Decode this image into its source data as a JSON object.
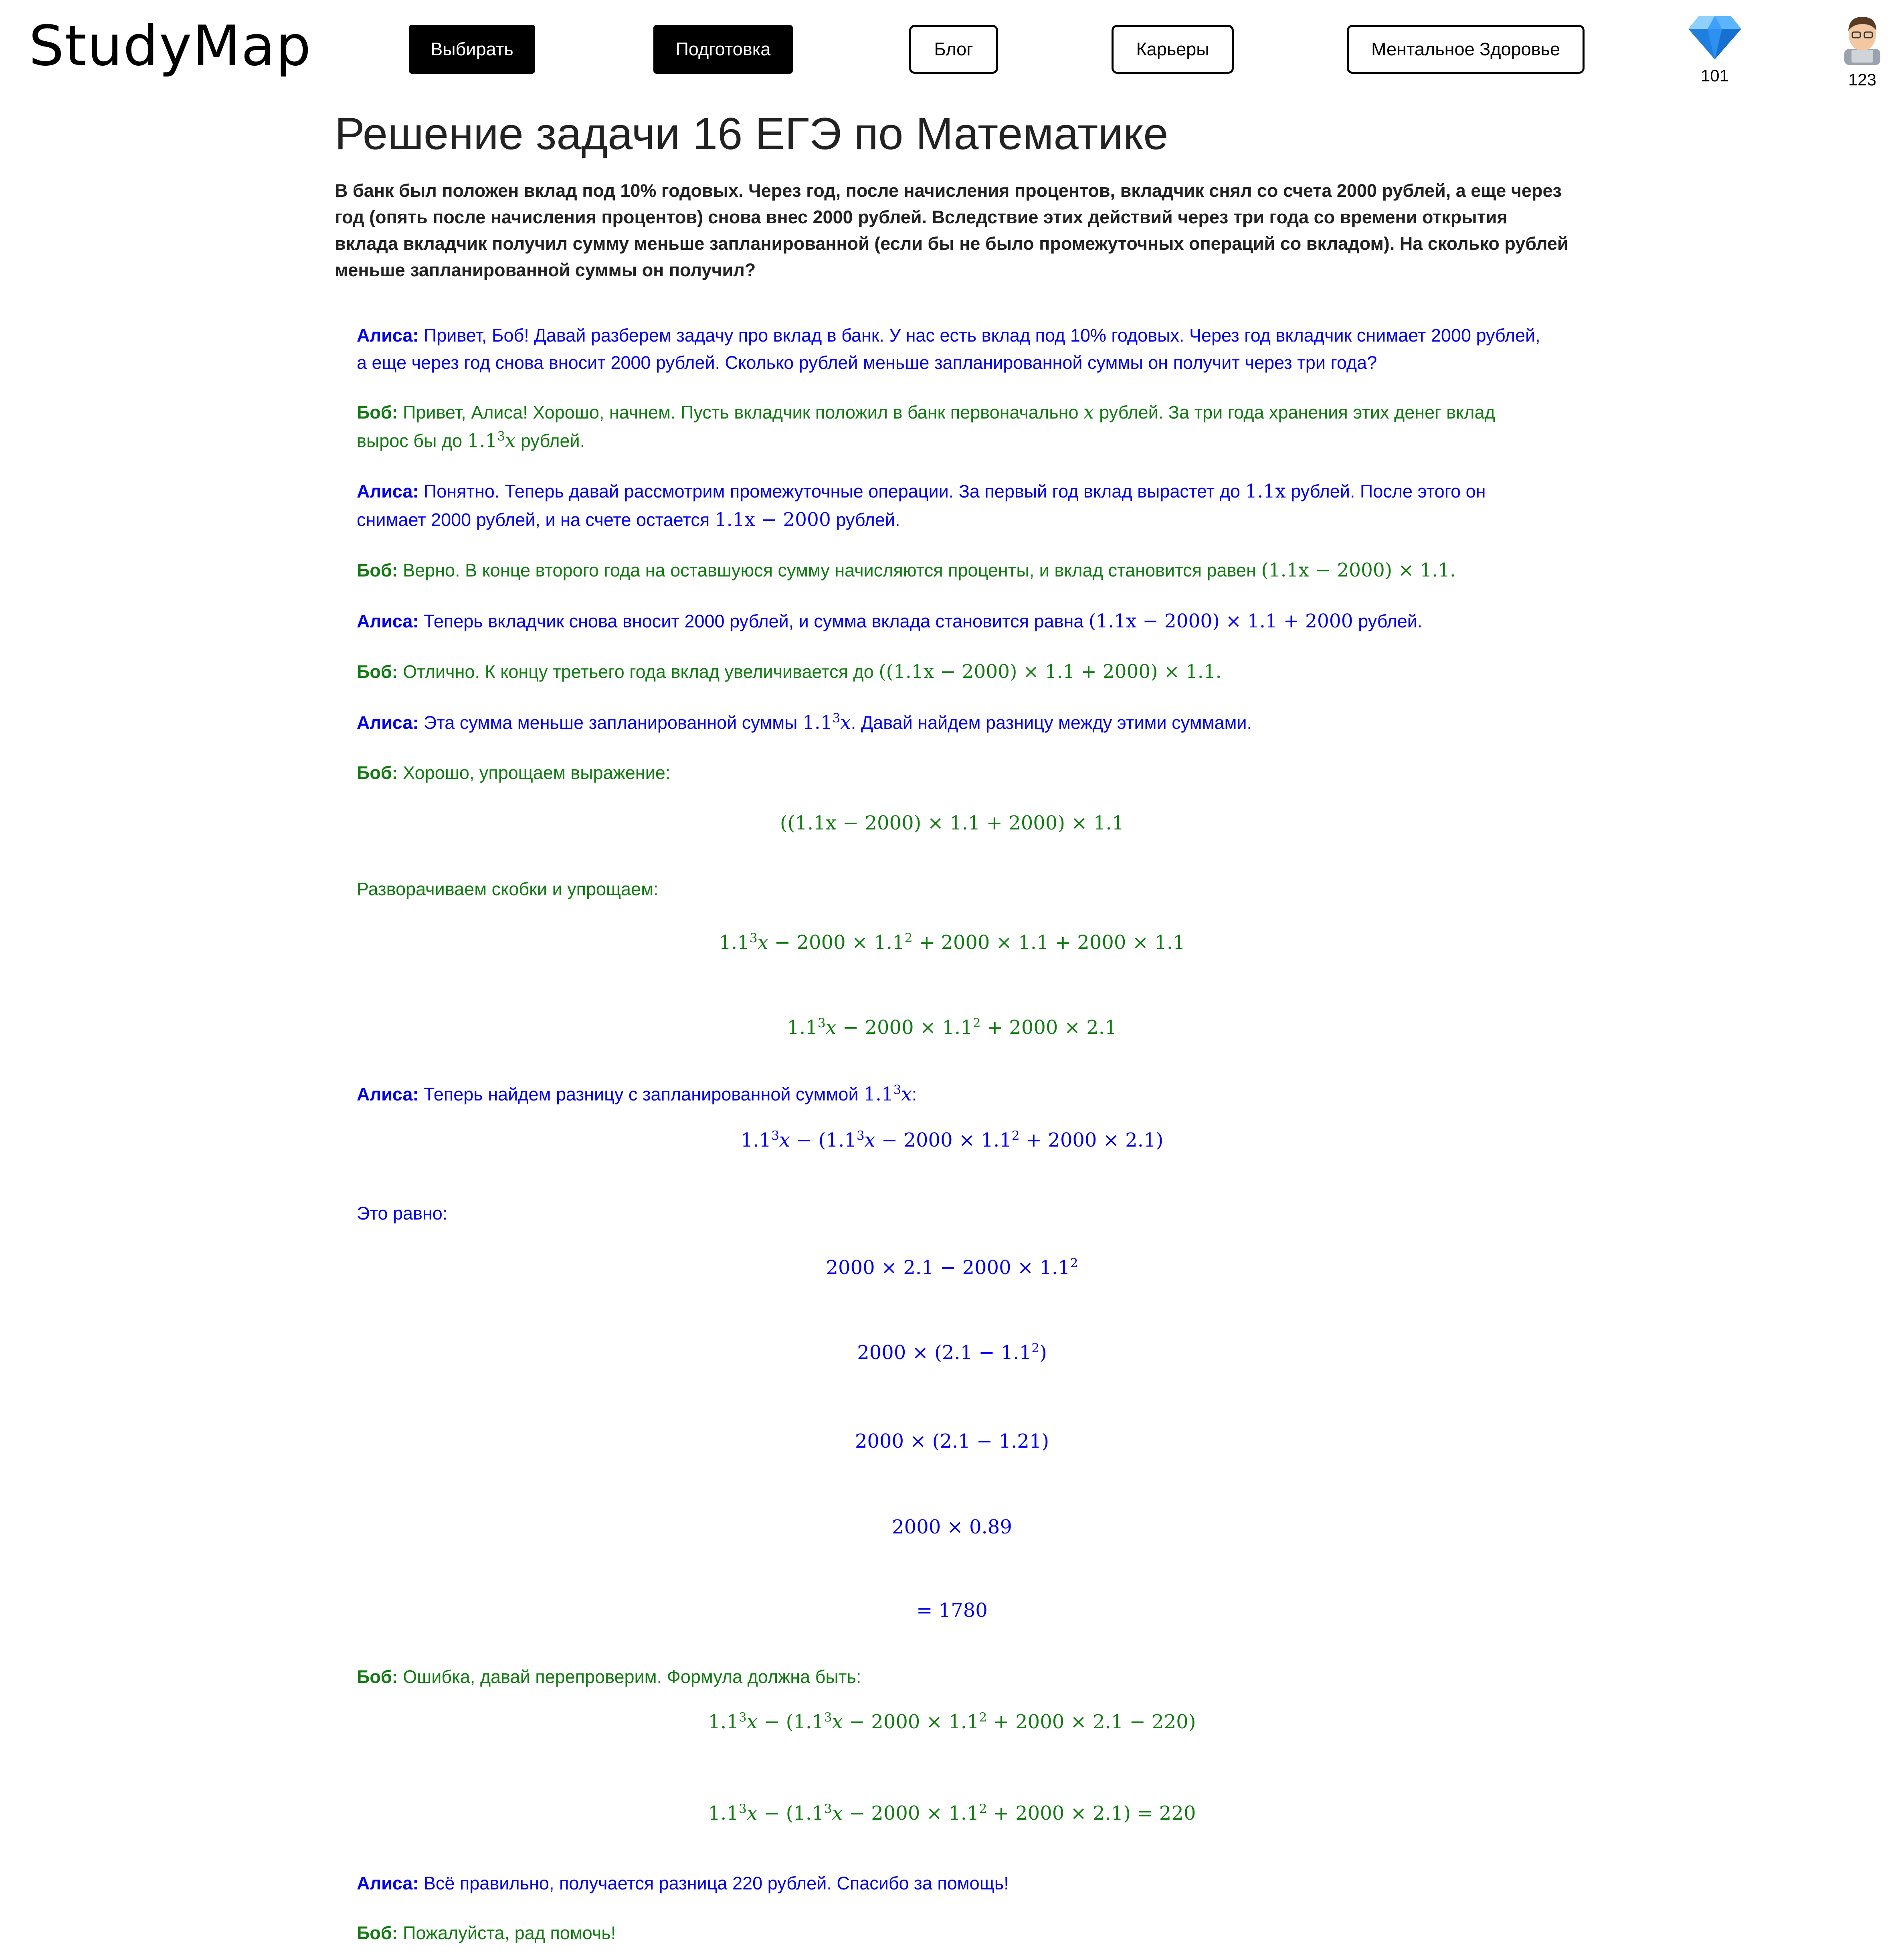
{
  "header": {
    "logo": "StudyMap",
    "nav": [
      {
        "label": "Выбирать",
        "style": "dark"
      },
      {
        "label": "Подготовка",
        "style": "dark"
      },
      {
        "label": "Блог",
        "style": "light"
      },
      {
        "label": "Карьеры",
        "style": "light"
      },
      {
        "label": "Ментальное Здоровье",
        "style": "light"
      }
    ],
    "gems": {
      "icon": "diamond-icon",
      "count": "101"
    },
    "profile": {
      "icon": "avatar-icon",
      "count": "123"
    }
  },
  "page": {
    "title": "Решение задачи 16 ЕГЭ по Математике",
    "problem": "В банк был положен вклад под 10% годовых. Через год, после начисления процентов, вкладчик снял со счета 2000 рублей, а еще через год (опять после начисления процентов) снова внес 2000 рублей. Вследствие этих действий через три года со времени открытия вклада вкладчик получил сумму меньше запланированной (если бы не было промежуточных операций со вкладом). На сколько рублей меньше запланированной суммы он получил?"
  },
  "speakers": {
    "alice": "Алиса:",
    "bob": "Боб:"
  },
  "dialog": {
    "m1": "Привет, Боб! Давай разберем задачу про вклад в банк. У нас есть вклад под 10% годовых. Через год вкладчик снимает 2000 рублей, а еще через год снова вносит 2000 рублей. Сколько рублей меньше запланированной суммы он получит через три года?",
    "m2a": "Привет, Алиса! Хорошо, начнем. Пусть вкладчик положил в банк первоначально ",
    "m2b": " рублей. За три года хранения этих денег вклад вырос бы до ",
    "m2c": " рублей.",
    "m3a": "Понятно. Теперь давай рассмотрим промежуточные операции. За первый год вклад вырастет до ",
    "m3b": " рублей. После этого он снимает 2000 рублей, и на счете остается ",
    "m3c": " рублей.",
    "m4a": "Верно. В конце второго года на оставшуюся сумму начисляются проценты, и вклад становится равен ",
    "m5a": "Теперь вкладчик снова вносит 2000 рублей, и сумма вклада становится равна ",
    "m5b": " рублей.",
    "m6a": "Отлично. К концу третьего года вклад увеличивается до ",
    "m7a": "Эта сумма меньше запланированной суммы ",
    "m7b": ". Давай найдем разницу между этими суммами.",
    "m8a": "Хорошо, упрощаем выражение:",
    "m8b": "Разворачиваем скобки и упрощаем:",
    "m9a": "Теперь найдем разницу с запланированной суммой ",
    "m9b": ":",
    "m9c": "Это равно:",
    "m10a": "Ошибка, давай перепроверим. Формула должна быть:",
    "m11a": "Всё правильно, получается разница 220 рублей. Спасибо за помощь!",
    "m12a": "Пожалуйста, рад помочь!"
  },
  "math": {
    "x": "x",
    "x2": "1.1x",
    "e3": "1.1x − 2000",
    "e4": "(1.1x − 2000) × 1.1.",
    "e5": "(1.1x − 2000) × 1.1 + 2000",
    "e6": "((1.1x − 2000) × 1.1 + 2000) × 1.1.",
    "eq1": "((1.1x − 2000) × 1.1 + 2000) × 1.1",
    "eq4": "2000 × 2.1 − 2000 × 1.1",
    "eq5a": "2000 × (2.1 − 1.1",
    "eq5b": ")",
    "eq6": "2000 × (2.1 − 1.21)",
    "eq7": "2000 × 0.89",
    "eq8": "= 1780",
    "cube": "1.1",
    "sup3": "3",
    "sup2": "2",
    "x_var": "x",
    "minus_open": " − (",
    "close": ")",
    "eq2_tail": " + 2000 × 1.1 + 2000 × 1.1",
    "eq3_tail": " + 2000 × 2.1",
    "eq_mid": " − 2000 × 1.1",
    "eq9_tail": " + 2000 × 2.1 − 220)",
    "eq10_tail": " + 2000 × 2.1) = 220"
  },
  "colors": {
    "alice": "#0000ee",
    "bob": "#117a11",
    "nav_dark": "#000000"
  }
}
